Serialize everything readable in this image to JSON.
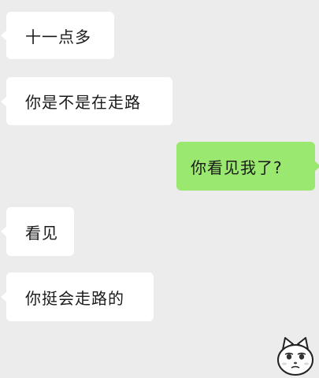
{
  "messages": [
    {
      "side": "left",
      "text": "十一点多"
    },
    {
      "side": "left",
      "text": "你是不是在走路"
    },
    {
      "side": "right",
      "text": "你看见我了?"
    },
    {
      "side": "left",
      "text": "看见"
    },
    {
      "side": "left",
      "text": "你挺会走路的"
    }
  ],
  "sticker": {
    "icon": "cat-face-sticker-icon"
  },
  "colors": {
    "background": "#ececec",
    "incoming_bubble": "#ffffff",
    "outgoing_bubble": "#9be870",
    "text": "#1a1a1a"
  }
}
